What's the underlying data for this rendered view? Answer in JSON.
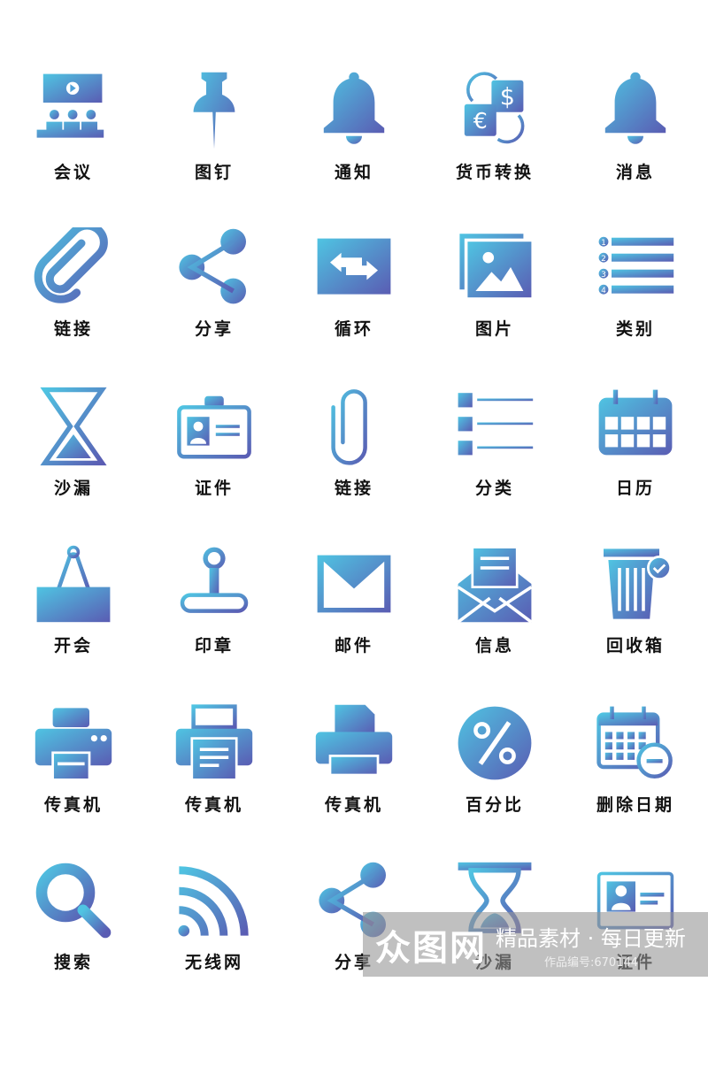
{
  "colors": {
    "gradient_start": "#4fc4e2",
    "gradient_end": "#5a5cb3",
    "label": "#111111"
  },
  "icons": [
    {
      "icon": "meeting-icon",
      "label": "会议"
    },
    {
      "icon": "pushpin-icon",
      "label": "图钉"
    },
    {
      "icon": "bell-icon",
      "label": "通知"
    },
    {
      "icon": "currency-exchange-icon",
      "label": "货币转换"
    },
    {
      "icon": "bell-icon",
      "label": "消息"
    },
    {
      "icon": "link-icon",
      "label": "链接"
    },
    {
      "icon": "share-icon",
      "label": "分享"
    },
    {
      "icon": "swap-arrows-icon",
      "label": "循环"
    },
    {
      "icon": "image-icon",
      "label": "图片"
    },
    {
      "icon": "numbered-list-icon",
      "label": "类别"
    },
    {
      "icon": "hourglass-outline-icon",
      "label": "沙漏"
    },
    {
      "icon": "id-badge-icon",
      "label": "证件"
    },
    {
      "icon": "paperclip-icon",
      "label": "链接"
    },
    {
      "icon": "list-icon",
      "label": "分类"
    },
    {
      "icon": "calendar-icon",
      "label": "日历"
    },
    {
      "icon": "binder-clip-icon",
      "label": "开会"
    },
    {
      "icon": "stamp-icon",
      "label": "印章"
    },
    {
      "icon": "envelope-icon",
      "label": "邮件"
    },
    {
      "icon": "open-envelope-icon",
      "label": "信息"
    },
    {
      "icon": "trash-check-icon",
      "label": "回收箱"
    },
    {
      "icon": "fax-icon",
      "label": "传真机"
    },
    {
      "icon": "printer-icon",
      "label": "传真机"
    },
    {
      "icon": "printer-document-icon",
      "label": "传真机"
    },
    {
      "icon": "percent-icon",
      "label": "百分比"
    },
    {
      "icon": "calendar-remove-icon",
      "label": "删除日期"
    },
    {
      "icon": "search-icon",
      "label": "搜索"
    },
    {
      "icon": "wifi-signal-icon",
      "label": "无线网"
    },
    {
      "icon": "share-icon",
      "label": "分享"
    },
    {
      "icon": "hourglass-icon",
      "label": "沙漏"
    },
    {
      "icon": "id-card-icon",
      "label": "证件"
    }
  ],
  "watermark": {
    "logo": "众图网",
    "slogan": "精品素材 · 每日更新",
    "code": "作品编号:670144"
  }
}
